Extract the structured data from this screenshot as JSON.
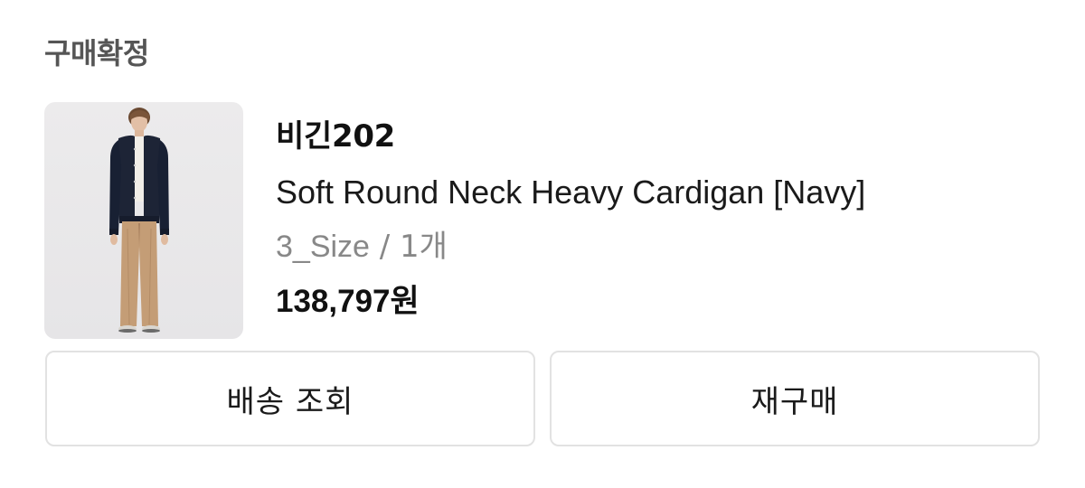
{
  "order": {
    "status_title": "구매확정"
  },
  "product": {
    "image_alt": "Model wearing navy round neck cardigan with beige wide pants",
    "brand": "비긴202",
    "name": "Soft Round Neck Heavy Cardigan [Navy]",
    "option_size": "3_Size",
    "option_separator": " / ",
    "option_quantity": "1개",
    "price_number": "138,797",
    "price_unit": "원"
  },
  "actions": {
    "track_delivery_label": "배송 조회",
    "rebuy_label": "재구매"
  },
  "colors": {
    "title_gray": "#555555",
    "option_gray": "#888888",
    "button_border": "#e2e2e2",
    "cardigan_navy": "#1c2333",
    "pants_beige": "#c29a72"
  }
}
